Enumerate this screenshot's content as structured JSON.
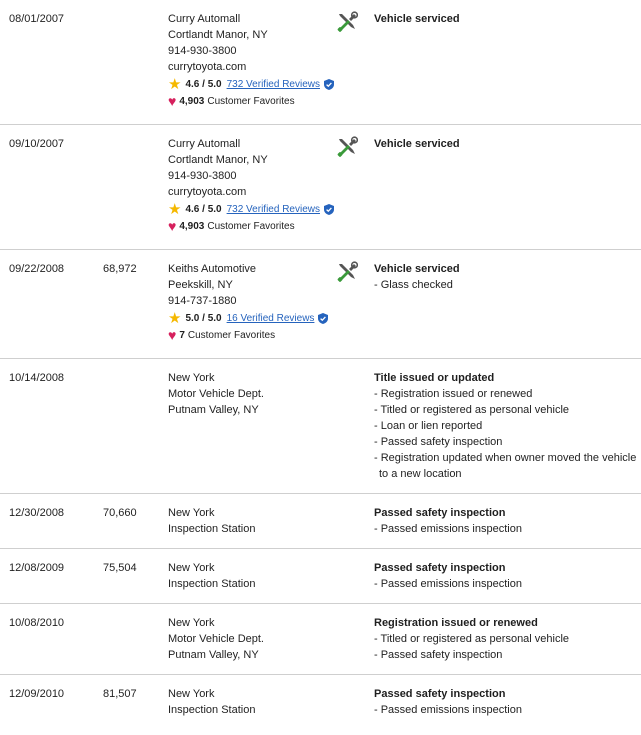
{
  "records": [
    {
      "date": "08/01/2007",
      "mileage": "",
      "source_lines": [
        "Curry Automall",
        "Cortlandt Manor, NY",
        "914-930-3800",
        "currytoyota.com"
      ],
      "rating": "4.6 / 5.0",
      "reviews": "732 Verified Reviews",
      "favorites_count": "4,903",
      "favorites_label": "Customer Favorites",
      "icon": "wrench-screwdriver-icon",
      "title": "Vehicle serviced",
      "items": []
    },
    {
      "date": "09/10/2007",
      "mileage": "",
      "source_lines": [
        "Curry Automall",
        "Cortlandt Manor, NY",
        "914-930-3800",
        "currytoyota.com"
      ],
      "rating": "4.6 / 5.0",
      "reviews": "732 Verified Reviews",
      "favorites_count": "4,903",
      "favorites_label": "Customer Favorites",
      "icon": "wrench-screwdriver-icon",
      "title": "Vehicle serviced",
      "items": []
    },
    {
      "date": "09/22/2008",
      "mileage": "68,972",
      "source_lines": [
        "Keiths Automotive",
        "Peekskill, NY",
        "914-737-1880"
      ],
      "rating": "5.0 / 5.0",
      "reviews": "16 Verified Reviews",
      "favorites_count": "7",
      "favorites_label": "Customer Favorites",
      "icon": "wrench-screwdriver-icon",
      "title": "Vehicle serviced",
      "items": [
        "- Glass checked"
      ]
    },
    {
      "date": "10/14/2008",
      "mileage": "",
      "source_lines": [
        "New York",
        "Motor Vehicle Dept.",
        "Putnam Valley, NY"
      ],
      "title": "Title issued or updated",
      "items": [
        "- Registration issued or renewed",
        "- Titled or registered as personal vehicle",
        "- Loan or lien reported",
        "- Passed safety inspection",
        "- Registration updated when owner moved the vehicle",
        "to a new location"
      ]
    },
    {
      "date": "12/30/2008",
      "mileage": "70,660",
      "source_lines": [
        "New York",
        "Inspection Station"
      ],
      "title": "Passed safety inspection",
      "items": [
        "- Passed emissions inspection"
      ]
    },
    {
      "date": "12/08/2009",
      "mileage": "75,504",
      "source_lines": [
        "New York",
        "Inspection Station"
      ],
      "title": "Passed safety inspection",
      "items": [
        "- Passed emissions inspection"
      ]
    },
    {
      "date": "10/08/2010",
      "mileage": "",
      "source_lines": [
        "New York",
        "Motor Vehicle Dept.",
        "Putnam Valley, NY"
      ],
      "title": "Registration issued or renewed",
      "items": [
        "- Titled or registered as personal vehicle",
        "- Passed safety inspection"
      ]
    },
    {
      "date": "12/09/2010",
      "mileage": "81,507",
      "source_lines": [
        "New York",
        "Inspection Station"
      ],
      "title": "Passed safety inspection",
      "items": [
        "- Passed emissions inspection"
      ]
    }
  ]
}
